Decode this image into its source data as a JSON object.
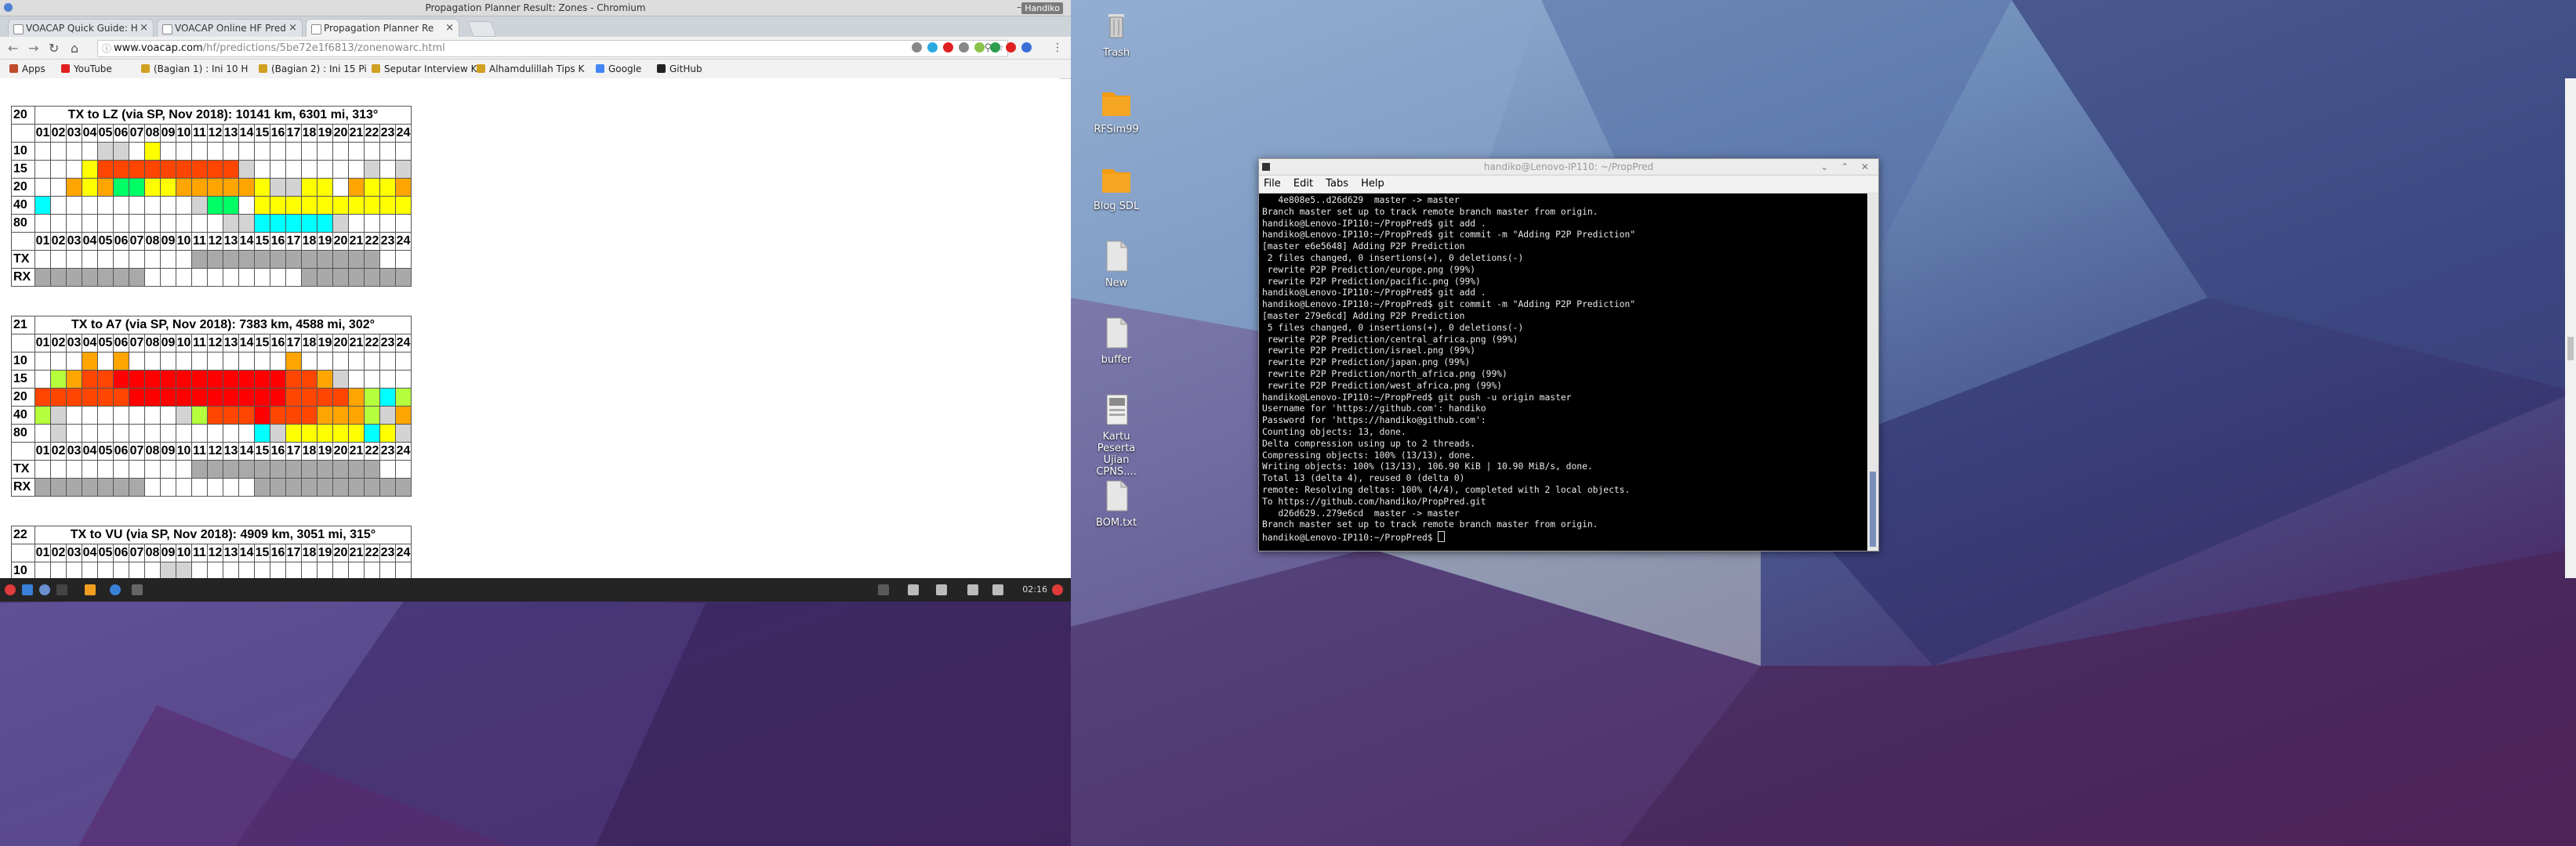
{
  "browser": {
    "window_title": "Propagation Planner Result: Zones - Chromium",
    "user_badge": "Handiko",
    "tabs": [
      {
        "label": "VOACAP Quick Guide: H"
      },
      {
        "label": "VOACAP Online HF Pred"
      },
      {
        "label": "Propagation Planner Re"
      }
    ],
    "url_host": "www.voacap.com",
    "url_path": "/hf/predictions/5be72e1f6813/zonenowarc.html",
    "bookmarks": [
      {
        "label": "Apps",
        "color": "#c04a2a"
      },
      {
        "label": "YouTube",
        "color": "#e02020"
      },
      {
        "label": "(Bagian 1) : Ini 10 H",
        "color": "#d0a020"
      },
      {
        "label": "(Bagian 2) : Ini 15 Pi",
        "color": "#d0a020"
      },
      {
        "label": "Seputar Interview K",
        "color": "#d0a020"
      },
      {
        "label": "Alhamdulillah Tips K",
        "color": "#d0a020"
      },
      {
        "label": "Google",
        "color": "#4285f4"
      },
      {
        "label": "GitHub",
        "color": "#222222"
      }
    ]
  },
  "hours": [
    "01",
    "02",
    "03",
    "04",
    "05",
    "06",
    "07",
    "08",
    "09",
    "10",
    "11",
    "12",
    "13",
    "14",
    "15",
    "16",
    "17",
    "18",
    "19",
    "20",
    "21",
    "22",
    "23",
    "24"
  ],
  "zones": [
    {
      "num": "20",
      "title": "TX to LZ (via SP, Nov 2018): 10141 km, 6301 mi, 313°",
      "bands": [
        {
          "label": "10",
          "cells": "....dd.y................"
        },
        {
          "label": "15",
          "cells": "...yrrrrrrrrrd.......d.d"
        },
        {
          "label": "20",
          "cells": "..oyoggyyoooooyddyy.oyyo"
        },
        {
          "label": "40",
          "cells": "c.........dgg.yyyyyyyyyy"
        },
        {
          "label": "80",
          "cells": "............ddcccccd...."
        }
      ],
      "tx": "..........xxxxxxxxxxxx..",
      "rx": "xxxxxxx..........xxxxxxx"
    },
    {
      "num": "21",
      "title": "TX to A7 (via SP, Nov 2018): 7383 km, 4588 mi, 302°",
      "bands": [
        {
          "label": "10",
          "cells": "...o.o..........o......."
        },
        {
          "label": "15",
          "cells": ".lorrRRRRRRRRRRRrrod...."
        },
        {
          "label": "20",
          "cells": "rrrrrrRRRRRRRRRRrrrrolcl"
        },
        {
          "label": "40",
          "cells": "ld.......dlrrrRrrroooldo"
        },
        {
          "label": "80",
          "cells": ".d............cdyyyyycyd"
        }
      ],
      "tx": "..........xxxxxxxxxxxx..",
      "rx": "xxxxxxx.......xxxxxxxxxx"
    },
    {
      "num": "22",
      "title": "TX to VU (via SP, Nov 2018): 4909 km, 3051 mi, 315°",
      "bands": [
        {
          "label": "10",
          "cells": "........dd.............."
        }
      ]
    }
  ],
  "colors": {
    "d": "#d3d3d3",
    "y": "#ffff00",
    "o": "#ffa500",
    "r": "#ff4500",
    "R": "#ff0000",
    "g": "#00ff66",
    "c": "#00ffff",
    "l": "#b6ff3c",
    "x": "#a9a9a9"
  },
  "taskbar": {
    "clock": "02:16"
  },
  "desktop_icons": [
    {
      "label": "Trash"
    },
    {
      "label": "RFSim99"
    },
    {
      "label": "Blog SDL"
    },
    {
      "label": "New"
    },
    {
      "label": "buffer"
    },
    {
      "label": "Kartu Peserta Ujian CPNS...."
    },
    {
      "label": "BOM.txt"
    }
  ],
  "terminal": {
    "title": "handiko@Lenovo-IP110: ~/PropPred",
    "menu": [
      "File",
      "Edit",
      "Tabs",
      "Help"
    ],
    "lines": [
      "   4e808e5..d26d629  master -> master",
      "Branch master set up to track remote branch master from origin.",
      "handiko@Lenovo-IP110:~/PropPred$ git add .",
      "handiko@Lenovo-IP110:~/PropPred$ git commit -m \"Adding P2P Prediction\"",
      "[master e6e5648] Adding P2P Prediction",
      " 2 files changed, 0 insertions(+), 0 deletions(-)",
      " rewrite P2P Prediction/europe.png (99%)",
      " rewrite P2P Prediction/pacific.png (99%)",
      "handiko@Lenovo-IP110:~/PropPred$ git add .",
      "handiko@Lenovo-IP110:~/PropPred$ git commit -m \"Adding P2P Prediction\"",
      "[master 279e6cd] Adding P2P Prediction",
      " 5 files changed, 0 insertions(+), 0 deletions(-)",
      " rewrite P2P Prediction/central_africa.png (99%)",
      " rewrite P2P Prediction/israel.png (99%)",
      " rewrite P2P Prediction/japan.png (99%)",
      " rewrite P2P Prediction/north_africa.png (99%)",
      " rewrite P2P Prediction/west_africa.png (99%)",
      "handiko@Lenovo-IP110:~/PropPred$ git push -u origin master",
      "Username for 'https://github.com': handiko",
      "Password for 'https://handiko@github.com':",
      "Counting objects: 13, done.",
      "Delta compression using up to 2 threads.",
      "Compressing objects: 100% (13/13), done.",
      "Writing objects: 100% (13/13), 106.90 KiB | 10.90 MiB/s, done.",
      "Total 13 (delta 4), reused 0 (delta 0)",
      "remote: Resolving deltas: 100% (4/4), completed with 2 local objects.",
      "To https://github.com/handiko/PropPred.git",
      "   d26d629..279e6cd  master -> master",
      "Branch master set up to track remote branch master from origin.",
      "handiko@Lenovo-IP110:~/PropPred$ "
    ]
  }
}
